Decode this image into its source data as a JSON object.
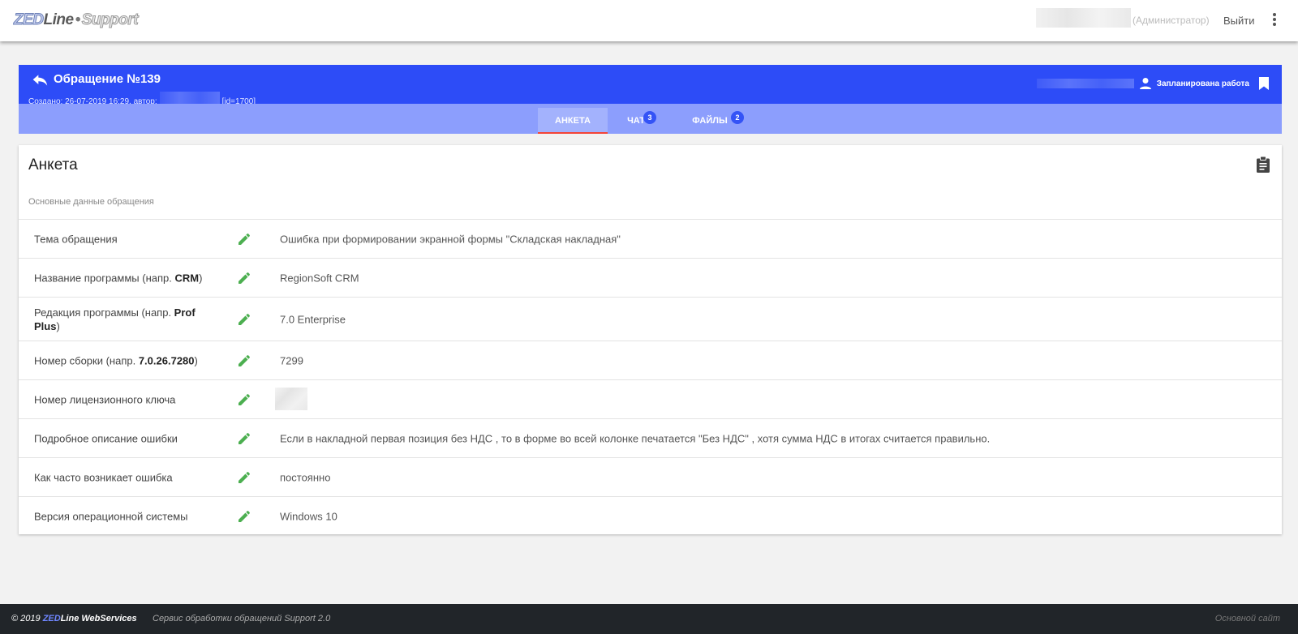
{
  "brand": {
    "zed": "ZED",
    "line": "Line",
    "dot": "•",
    "support": "Support"
  },
  "header": {
    "role": "(Администратор)",
    "logout": "Выйти"
  },
  "ticket": {
    "title": "Обращение №139",
    "meta_prefix": "Создано: 26-07-2019 16:29, автор:",
    "meta_id": "[id=1700]",
    "status": "Запланирована работа"
  },
  "tabs": [
    {
      "label": "АНКЕТА",
      "badge": ""
    },
    {
      "label": "ЧАТ",
      "badge": "3"
    },
    {
      "label": "ФАЙЛЫ",
      "badge": "2"
    }
  ],
  "card": {
    "title": "Анкета",
    "subtitle": "Основные данные обращения",
    "rows": [
      {
        "label": "Тема обращения",
        "value": "Ошибка при формировании экранной формы \"Складская накладная\""
      },
      {
        "label_pre": "Название программы (напр. ",
        "label_bold": "CRM",
        "label_post": ")",
        "value": "RegionSoft CRM"
      },
      {
        "label_pre": "Редакция программы (напр. ",
        "label_bold": "Prof Plus",
        "label_post": ")",
        "value": "7.0 Enterprise"
      },
      {
        "label_pre": "Номер сборки (напр. ",
        "label_bold": "7.0.26.7280",
        "label_post": ")",
        "value": "7299"
      },
      {
        "label": "Номер лицензионного ключа",
        "value": ""
      },
      {
        "label": "Подробное описание ошибки",
        "value": "Если в накладной первая позиция без НДС , то в форме во всей колонке печатается \"Без НДС\" , хотя сумма НДС в итогах считается правильно."
      },
      {
        "label": "Как часто возникает ошибка",
        "value": "постоянно"
      },
      {
        "label": "Версия операционной системы",
        "value": "Windows 10"
      }
    ]
  },
  "footer": {
    "copy": "© 2019",
    "brand_zed": "ZED",
    "brand_rest": "Line WebServices",
    "service": "Сервис обработки обращений Support 2.0",
    "site_link": "Основной сайт"
  },
  "colors": {
    "primary": "#2d4cf7",
    "tabbar": "#8c9efd",
    "active_tab_underline": "#f44336",
    "edit_icon": "#4caf50",
    "footer_bg": "#212529"
  }
}
